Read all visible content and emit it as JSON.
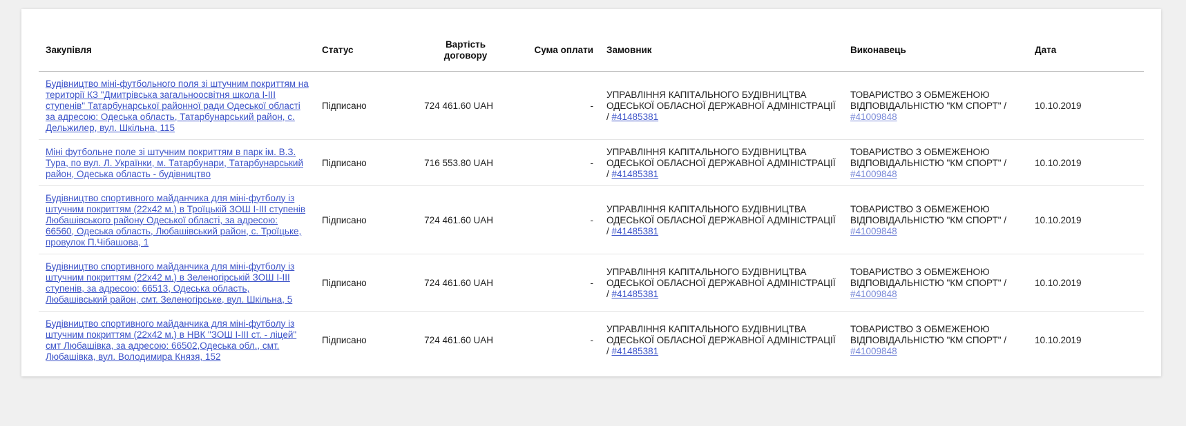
{
  "table": {
    "headers": {
      "procurement": "Закупівля",
      "status": "Статус",
      "contract_value": "Вартість договору",
      "payment_sum": "Сума оплати",
      "customer": "Замовник",
      "contractor": "Виконавець",
      "date": "Дата"
    },
    "rows": [
      {
        "procurement": "Будівництво міні-футбольного поля зі штучним покриттям на території КЗ \"Дмитрівська загальноосвітня школа І-ІІІ ступенів\" Татарбунарської районної ради Одеської області за адресою: Одеська область, Татарбунарський район, с. Дельжилер, вул. Шкільна, 115",
        "status": "Підписано",
        "contract_value": "724 461.60 UAH",
        "payment_sum": "-",
        "customer_name": "УПРАВЛІННЯ КАПІТАЛЬНОГО БУДІВНИЦТВА ОДЕСЬКОЇ ОБЛАСНОЇ ДЕРЖАВНОЇ АДМІНІСТРАЦІЇ / ",
        "customer_code": "#41485381",
        "contractor_name": "ТОВАРИСТВО З ОБМЕЖЕНОЮ ВІДПОВІДАЛЬНІСТЮ \"КМ СПОРТ\" / ",
        "contractor_code": "#41009848",
        "date": "10.10.2019"
      },
      {
        "procurement": "Міні футбольне поле зі штучним покриттям в парк ім. В.З. Тура, по вул. Л. Українки, м. Татарбунари, Татарбунарський район, Одеська область - будівництво",
        "status": "Підписано",
        "contract_value": "716 553.80 UAH",
        "payment_sum": "-",
        "customer_name": "УПРАВЛІННЯ КАПІТАЛЬНОГО БУДІВНИЦТВА ОДЕСЬКОЇ ОБЛАСНОЇ ДЕРЖАВНОЇ АДМІНІСТРАЦІЇ / ",
        "customer_code": "#41485381",
        "contractor_name": "ТОВАРИСТВО З ОБМЕЖЕНОЮ ВІДПОВІДАЛЬНІСТЮ \"КМ СПОРТ\" / ",
        "contractor_code": "#41009848",
        "date": "10.10.2019"
      },
      {
        "procurement": "Будівництво спортивного майданчика для міні-футболу із штучним покриттям (22х42 м.) в Троїцькій ЗОШ І-ІІІ ступенів Любашівського району Одеської області, за адресою: 66560, Одеська область, Любашівський район, с. Троїцьке, провулок П.Чібашова, 1",
        "status": "Підписано",
        "contract_value": "724 461.60 UAH",
        "payment_sum": "-",
        "customer_name": "УПРАВЛІННЯ КАПІТАЛЬНОГО БУДІВНИЦТВА ОДЕСЬКОЇ ОБЛАСНОЇ ДЕРЖАВНОЇ АДМІНІСТРАЦІЇ / ",
        "customer_code": "#41485381",
        "contractor_name": "ТОВАРИСТВО З ОБМЕЖЕНОЮ ВІДПОВІДАЛЬНІСТЮ \"КМ СПОРТ\" / ",
        "contractor_code": "#41009848",
        "date": "10.10.2019"
      },
      {
        "procurement": "Будівництво спортивного майданчика для міні-футболу із штучним покриттям (22х42 м.) в Зеленогірській ЗОШ І-ІІІ ступенів, за адресою: 66513, Одеська область, Любашівський район, смт. Зеленогірське, вул. Шкільна, 5",
        "status": "Підписано",
        "contract_value": "724 461.60 UAH",
        "payment_sum": "-",
        "customer_name": "УПРАВЛІННЯ КАПІТАЛЬНОГО БУДІВНИЦТВА ОДЕСЬКОЇ ОБЛАСНОЇ ДЕРЖАВНОЇ АДМІНІСТРАЦІЇ / ",
        "customer_code": "#41485381",
        "contractor_name": "ТОВАРИСТВО З ОБМЕЖЕНОЮ ВІДПОВІДАЛЬНІСТЮ \"КМ СПОРТ\" / ",
        "contractor_code": "#41009848",
        "date": "10.10.2019"
      },
      {
        "procurement": "Будівництво спортивного майданчика для міні-футболу із штучним покриттям (22х42 м.) в НВК \"ЗОШ І-ІІІ ст. - ліцей\" смт Любашівка, за адресою: 66502,Одеська обл., смт. Любашівка, вул. Володимира Князя, 152",
        "status": "Підписано",
        "contract_value": "724 461.60 UAH",
        "payment_sum": "-",
        "customer_name": "УПРАВЛІННЯ КАПІТАЛЬНОГО БУДІВНИЦТВА ОДЕСЬКОЇ ОБЛАСНОЇ ДЕРЖАВНОЇ АДМІНІСТРАЦІЇ / ",
        "customer_code": "#41485381",
        "contractor_name": "ТОВАРИСТВО З ОБМЕЖЕНОЮ ВІДПОВІДАЛЬНІСТЮ \"КМ СПОРТ\" / ",
        "contractor_code": "#41009848",
        "date": "10.10.2019"
      }
    ]
  },
  "colors": {
    "link": "#3d54c9",
    "link_light": "#7a8ad8",
    "page_bg": "#f0f0f0",
    "card_bg": "#ffffff"
  }
}
